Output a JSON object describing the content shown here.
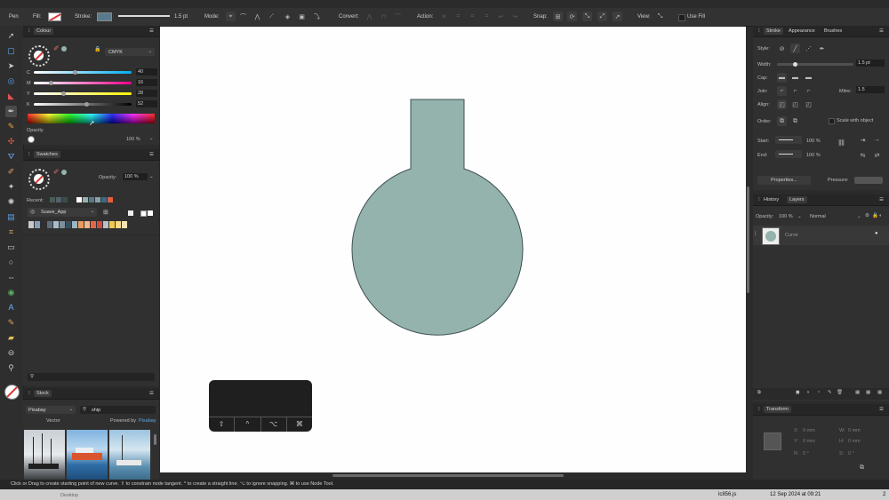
{
  "context_toolbar": {
    "tool_name": "Pen",
    "fill_label": "Fill:",
    "stroke_label": "Stroke:",
    "stroke_width": "1.5 pt",
    "mode_label": "Mode:",
    "convert_label": "Convert:",
    "action_label": "Action:",
    "snap_label": "Snap:",
    "view_label": "View:",
    "use_fill_label": "Use Fill",
    "stroke_color": "#5a7a8c"
  },
  "colour_panel": {
    "title": "Colour",
    "model": "CMYK",
    "channels": [
      {
        "label": "C",
        "value": "40"
      },
      {
        "label": "M",
        "value": "16"
      },
      {
        "label": "Y",
        "value": "28"
      },
      {
        "label": "K",
        "value": "52"
      }
    ],
    "opacity_label": "Opacity",
    "opacity_value": "100 %"
  },
  "swatches_panel": {
    "title": "Swatches",
    "opacity_label": "Opacity:",
    "opacity_value": "100 %",
    "recent_label": "Recent:",
    "palette_name": "Suave_App"
  },
  "stock_panel": {
    "title": "Stock",
    "source": "Pixabay",
    "search_value": "ship",
    "type_label": "Vector",
    "powered_label": "Powered by",
    "powered_brand": "Pixabay"
  },
  "stroke_panel": {
    "tabs": [
      "Stroke",
      "Appearance",
      "Brushes"
    ],
    "style_label": "Style:",
    "width_label": "Width:",
    "width_value": "1.5 pt",
    "cap_label": "Cap:",
    "join_label": "Join:",
    "mitre_label": "Mitre:",
    "mitre_value": "1.5",
    "align_label": "Align:",
    "order_label": "Order:",
    "scale_with_object": "Scale with object",
    "start_label": "Start:",
    "end_label": "End:",
    "start_pct": "100 %",
    "end_pct": "100 %",
    "properties_button": "Properties...",
    "pressure_label": "Pressure:"
  },
  "layers_panel": {
    "tabs": [
      "History",
      "Layers"
    ],
    "opacity_label": "Opacity:",
    "opacity_value": "100 %",
    "blend_mode": "Normal",
    "layer_name": "Curve"
  },
  "transform_panel": {
    "title": "Transform",
    "x_label": "X:",
    "x_value": "0 mm",
    "y_label": "Y:",
    "y_value": "0 mm",
    "w_label": "W:",
    "w_value": "0 mm",
    "h_label": "H:",
    "h_value": "0 mm",
    "r_label": "R:",
    "r_value": "0 °",
    "s_label": "S:",
    "s_value": "0 °"
  },
  "status_bar": {
    "hint": "Click or Drag to create starting point of new curve. ⇧ to constrain node tangent. ^ to create a straight line. ⌥ to ignore snapping. ⌘ to use Node Tool."
  },
  "modifier_keys": {
    "shift": "⇧",
    "ctrl": "^",
    "option": "⌥",
    "command": "⌘"
  },
  "shape": {
    "fill": "#94b3ac",
    "stroke": "#3e4f55"
  },
  "taskbar": {
    "desktop_label": "Desktop",
    "file_label": "lc856.js",
    "datetime": "12 Sep 2024 at 09:21",
    "page": "2"
  }
}
